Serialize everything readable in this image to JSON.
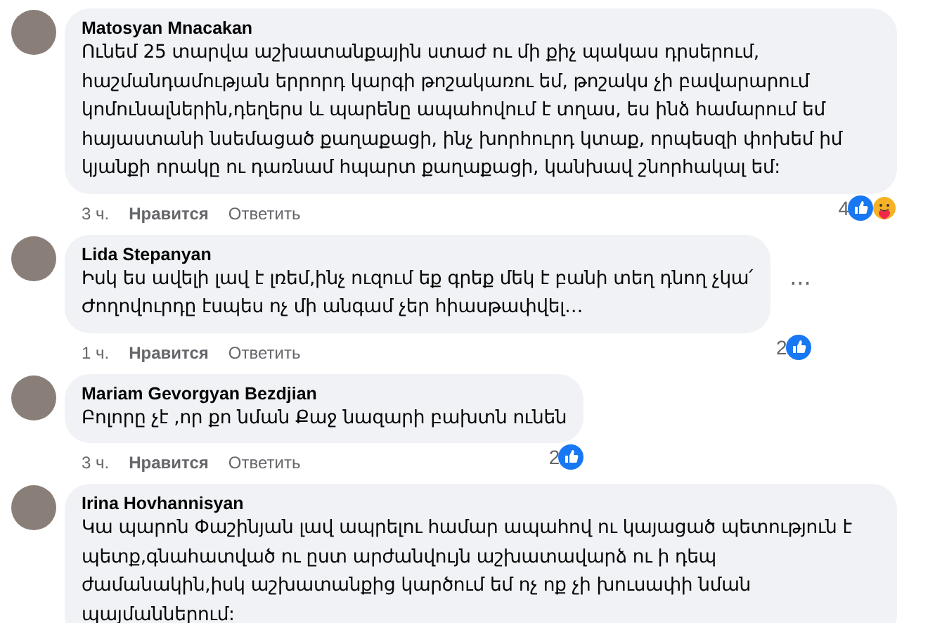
{
  "comments": [
    {
      "author": "Matosyan Mnacakan",
      "text": "Ունեմ 25 տարվա աշխատանքային ստաժ ու մի քիչ պակաս դրսերում, հաշմանդամության երրորդ կարգի թոշակառու եմ, թոշակս չի բավարարում կոմունալներին,դեղերս և պարենը ապահովում է տղաս, ես ինձ համարում եմ հայաստանի նսեմացած քաղաքացի, ինչ խորհուրդ կտաք, որպեսզի փոխեմ իմ կյանքի որակը ու դառնամ հպարտ քաղաքացի, կանխավ շնորհակալ եմ:",
      "time": "3 ч.",
      "like": "Нравится",
      "reply": "Ответить",
      "reaction_count": "4",
      "reactions": [
        {
          "kind": "like"
        },
        {
          "kind": "care"
        }
      ]
    },
    {
      "author": "Lida Stepanyan",
      "text": "Իսկ ես ավելի լավ է լռեմ,ինչ ուզում եք գրեք մեկ է բանի տեղ դնող չկա՛\nԺողովուրդը էսպես ոչ մի անգամ չեր հիասթափվել…",
      "time": "1 ч.",
      "like": "Нравится",
      "reply": "Ответить",
      "reaction_count": "2",
      "reactions": [
        {
          "kind": "like"
        }
      ],
      "more": "···"
    },
    {
      "author": "Mariam Gevorgyan Bezdjian",
      "text": "Բոլորը չէ ,որ քո նման Քաջ նազարի բախտն ունեն",
      "time": "3 ч.",
      "like": "Нравится",
      "reply": "Ответить",
      "reaction_count": "2",
      "reactions": [
        {
          "kind": "like"
        }
      ]
    },
    {
      "author": "Irina Hovhannisyan",
      "text": "Կա պարոն Փաշինյան լավ ապրելու համար ապահով ու կայացած պետություն է պետք,գնահատված ու ըստ արժանվույն աշխատավարձ ու ի դեպ ժամանակին,իսկ աշխատանքից կարծում եմ ոչ ոք չի խուսափի նման պայմաններում:"
    }
  ]
}
